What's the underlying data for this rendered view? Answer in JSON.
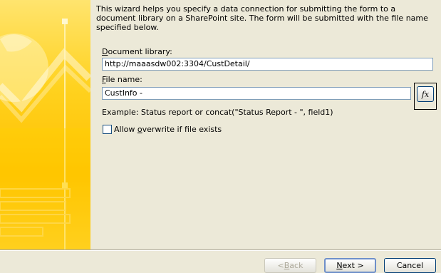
{
  "description": "This wizard helps you specify a data connection for submitting the form to a document library on a SharePoint site. The form will be submitted with the file name specified below.",
  "document_library": {
    "label_mnemonic": "D",
    "label_rest": "ocument library:",
    "value": "http://maaasdw002:3304/CustDetail/"
  },
  "file_name": {
    "label_mnemonic": "F",
    "label_rest": "ile name:",
    "value": "CustInfo -"
  },
  "formula_button": {
    "label": "fx"
  },
  "example": "Example: Status report or concat(\"Status Report - \", field1)",
  "overwrite": {
    "label_before": "Allow ",
    "label_mnemonic": "o",
    "label_after": "verwrite if file exists",
    "checked": false
  },
  "buttons": {
    "back_before": "< ",
    "back_mnemonic": "B",
    "back_after": "ack",
    "next_mnemonic": "N",
    "next_after": "ext >",
    "cancel": "Cancel"
  },
  "colors": {
    "banner_yellow": "#ffd21f",
    "dialog_background": "#ece9d8",
    "input_border": "#7f9db9"
  }
}
